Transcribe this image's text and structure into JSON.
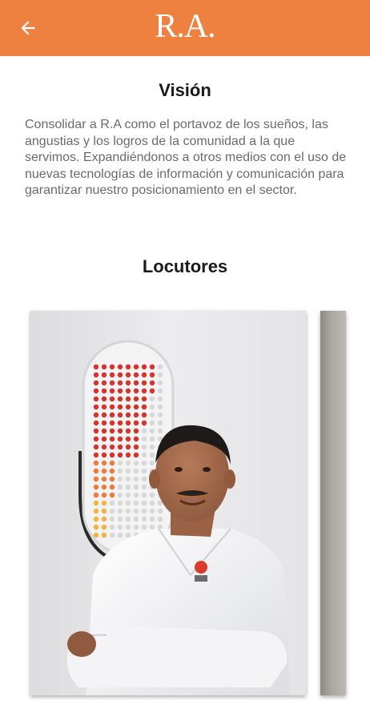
{
  "header": {
    "logo_text": "R.A.",
    "background_color": "#ee8140",
    "back_icon": "arrow-left-icon"
  },
  "vision": {
    "title": "Visión",
    "text": "Consolidar a R.A como el portavoz de los sueños, las angustias y los logros de la comunidad a la que servimos. Expandiéndonos a otros medios con el uso de nuevas tecnologías de información y comunicación para garantizar nuestro posicionamiento en el sector."
  },
  "locutores": {
    "title": "Locutores"
  }
}
